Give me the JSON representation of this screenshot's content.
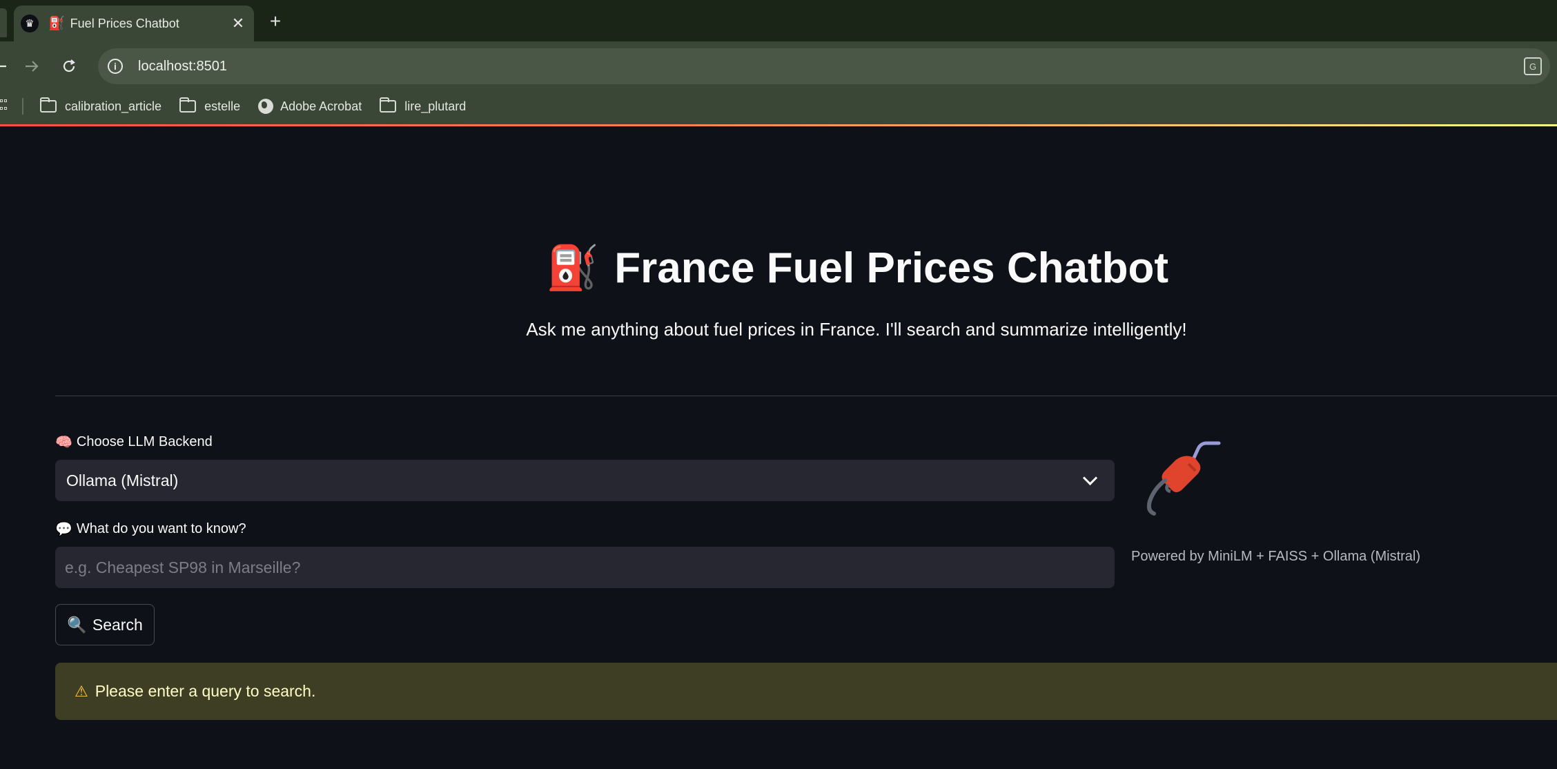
{
  "browser": {
    "tab_title": "Fuel Prices Chatbot",
    "tab_emoji": "⛽",
    "favicon_glyph": "♛",
    "close_glyph": "✕",
    "new_tab_glyph": "+",
    "url": "localhost:8501",
    "bookmarks": [
      {
        "label": "calibration_article",
        "icon": "folder-icon"
      },
      {
        "label": "estelle",
        "icon": "folder-icon"
      },
      {
        "label": "Adobe Acrobat",
        "icon": "globe-icon"
      },
      {
        "label": "lire_plutard",
        "icon": "folder-icon"
      }
    ]
  },
  "app": {
    "title_emoji": "⛽",
    "title": "France Fuel Prices Chatbot",
    "subtitle": "Ask me anything about fuel prices in France. I'll search and summarize intelligently!",
    "backend_label_emoji": "🧠",
    "backend_label": "Choose LLM Backend",
    "backend_selected": "Ollama (Mistral)",
    "query_label_emoji": "💬",
    "query_label": "What do you want to know?",
    "query_placeholder": "e.g. Cheapest SP98 in Marseille?",
    "query_value": "",
    "search_emoji": "🔍",
    "search_label": "Search",
    "warning_icon": "⚠",
    "warning_text": "Please enter a query to search.",
    "powered_by": "Powered by MiniLM + FAISS + Ollama (Mistral)"
  },
  "colors": {
    "background": "#0e1117",
    "chrome": "#3a4636",
    "tabstrip": "#1a2518",
    "input_bg": "#262730",
    "warning_bg": "#3e3e24",
    "warning_text": "#fffcc4",
    "accent_gradient": [
      "#ff4b4b",
      "#fffd80"
    ]
  }
}
